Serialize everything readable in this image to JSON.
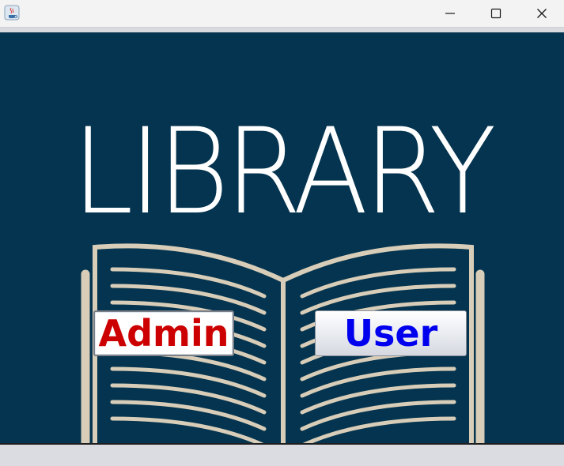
{
  "window": {
    "title_icon": "java-app-icon",
    "controls": [
      "minimize-icon",
      "maximize-icon",
      "close-icon"
    ]
  },
  "hero": {
    "title": "LIBRARY",
    "background_color": "#04344f",
    "book_color": "#d8cdb8"
  },
  "buttons": {
    "admin_label": "Admin",
    "admin_color": "#cc0000",
    "user_label": "User",
    "user_color": "#0000ee"
  }
}
